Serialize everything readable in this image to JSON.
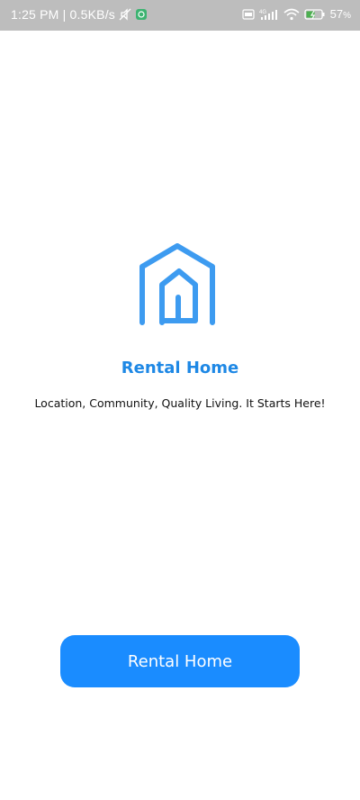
{
  "status_bar": {
    "time_speed": "1:25 PM | 0.5KB/s",
    "network": "4G",
    "battery": "57",
    "battery_unit": "%",
    "icons": [
      "mute-icon",
      "app-notification-icon",
      "hd-icon",
      "signal-icon",
      "wifi-icon",
      "battery-charging-icon"
    ]
  },
  "app": {
    "logo_icon": "house-icon",
    "title": "Rental Home",
    "tagline": "Location, Community, Quality Living. It Starts Here!",
    "button_label": "Rental Home"
  },
  "colors": {
    "accent": "#1a8cff",
    "title": "#1e88e5",
    "logo": "#3d9bf0",
    "status_bar": "#bdbdbd"
  }
}
